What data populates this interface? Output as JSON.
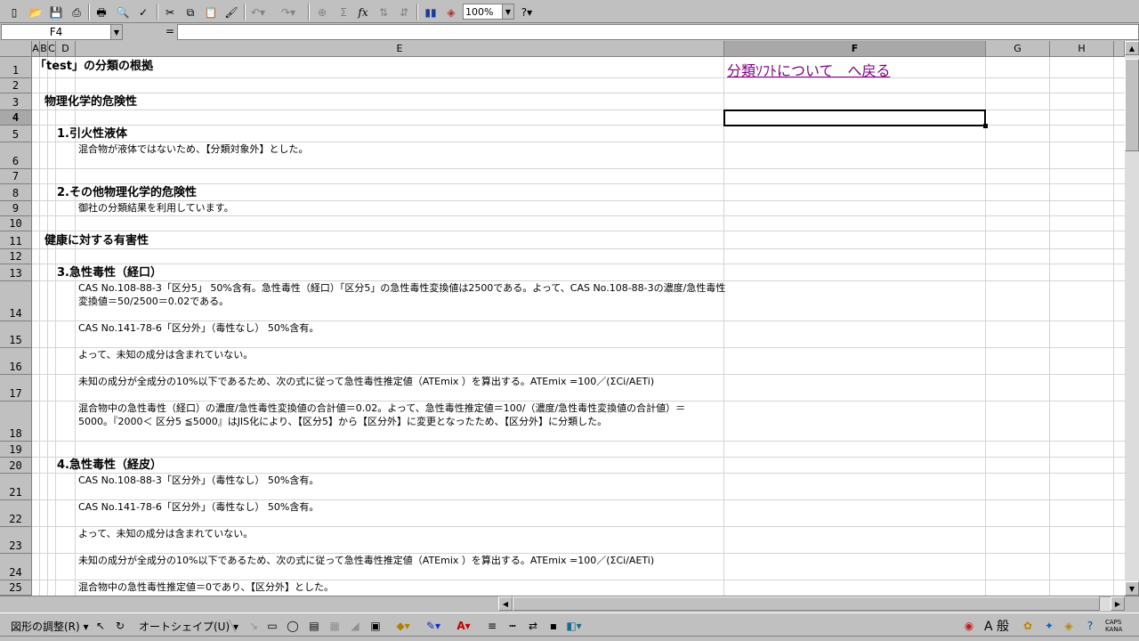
{
  "toolbar": {
    "zoom": "100%",
    "icons": [
      "new-icon",
      "open-icon",
      "save-icon",
      "permission-icon",
      "print-icon",
      "print-preview-icon",
      "spelling-icon",
      "cut-icon",
      "copy-icon",
      "paste-icon",
      "format-painter-icon",
      "undo-icon",
      "redo-icon",
      "hyperlink-icon",
      "autosum-icon",
      "function-icon",
      "sort-asc-icon",
      "sort-desc-icon",
      "chart-wizard-icon",
      "drawing-icon",
      "help-icon"
    ]
  },
  "formula_bar": {
    "name_box": "F4",
    "equals": "=",
    "formula": ""
  },
  "columns": [
    "A",
    "B",
    "C",
    "D",
    "E",
    "F",
    "G",
    "H"
  ],
  "selected_cell": "F4",
  "rows": [
    "1",
    "2",
    "3",
    "4",
    "5",
    "6",
    "7",
    "8",
    "9",
    "10",
    "11",
    "12",
    "13",
    "14",
    "15",
    "16",
    "17",
    "18",
    "19",
    "20",
    "21",
    "22",
    "23",
    "24",
    "25"
  ],
  "sheet": {
    "title": "「test」の分類の根拠",
    "back_link": "分類ｿﾌﾄについて　へ戻る",
    "section_physical": "物理化学的危険性",
    "h1": "1.引火性液体",
    "t1": "混合物が液体ではないため、【分類対象外】とした。",
    "h2": "2.その他物理化学的危険性",
    "t2": "御社の分類結果を利用しています。",
    "section_health": "健康に対する有害性",
    "h3": "3.急性毒性（経口）",
    "t3a_line1": "CAS No.108-88-3「区分5」 50%含有。急性毒性（経口）「区分5」の急性毒性変換値は2500である。よって、CAS No.108-88-3の濃度/急性毒性",
    "t3a_line2": "変換値＝50/2500＝0.02である。",
    "t3b": "CAS No.141-78-6「区分外」（毒性なし） 50%含有。",
    "t3c": "よって、未知の成分は含まれていない。",
    "t3d": "未知の成分が全成分の10%以下であるため、次の式に従って急性毒性推定値（ATEmix ）を算出する。ATEmix =100／(ΣCi/AETi)",
    "t3e_line1": "混合物中の急性毒性（経口）の濃度/急性毒性変換値の合計値＝0.02。よって、急性毒性推定値＝100/（濃度/急性毒性変換値の合計値）＝",
    "t3e_line2": "5000。『2000＜ 区分5 ≦5000』はJIS化により、【区分5】から【区分外】に変更となったため、【区分外】に分類した。",
    "h4": "4.急性毒性（経皮）",
    "t4a": "CAS No.108-88-3「区分外」（毒性なし） 50%含有。",
    "t4b": "CAS No.141-78-6「区分外」（毒性なし） 50%含有。",
    "t4c": "よって、未知の成分は含まれていない。",
    "t4d": "未知の成分が全成分の10%以下であるため、次の式に従って急性毒性推定値（ATEmix ）を算出する。ATEmix =100／(ΣCi/AETi)",
    "t4e": "混合物中の急性毒性推定値＝0であり、【区分外】とした。"
  },
  "drawbar": {
    "draw_menu": "図形の調整(R) ▾",
    "autoshapes": "オートシェイプ(U) ▾",
    "ime_text": "A 般"
  }
}
